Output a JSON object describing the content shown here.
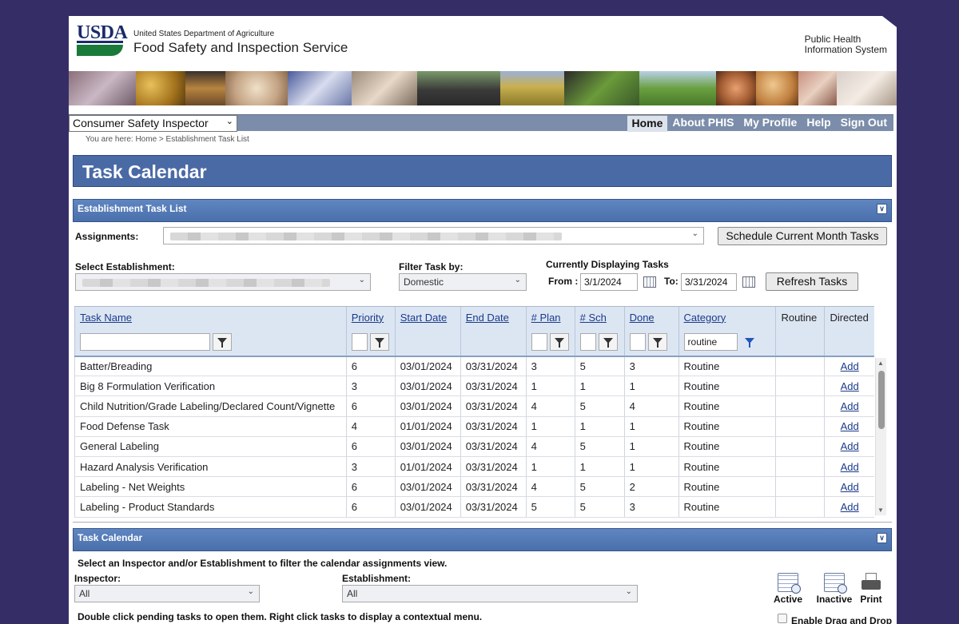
{
  "header": {
    "logo_text": "USDA",
    "agency_small": "United States Department of Agriculture",
    "agency_big": "Food Safety and Inspection Service",
    "system_line1": "Public Health",
    "system_line2": "Information System"
  },
  "nav": {
    "role": "Consumer Safety Inspector",
    "links": [
      "Home",
      "About PHIS",
      "My Profile",
      "Help",
      "Sign Out"
    ],
    "active": "Home"
  },
  "breadcrumb": "You are here: Home > Establishment Task List",
  "page_title": "Task Calendar",
  "task_list": {
    "section_title": "Establishment Task List",
    "assignments_label": "Assignments:",
    "schedule_button": "Schedule Current Month Tasks",
    "select_establishment_label": "Select Establishment:",
    "filter_label": "Filter Task by:",
    "filter_value": "Domestic",
    "displaying_label": "Currently Displaying Tasks",
    "from_label": "From :",
    "from_value": "3/1/2024",
    "to_label": "To:",
    "to_value": "3/31/2024",
    "refresh_button": "Refresh Tasks",
    "columns": [
      "Task Name",
      "Priority",
      "Start Date",
      "End Date",
      "# Plan",
      "# Sch",
      "Done",
      "Category",
      "Routine",
      "Directed"
    ],
    "category_filter": "routine",
    "rows": [
      {
        "name": "Batter/Breading",
        "priority": "6",
        "start": "03/01/2024",
        "end": "03/31/2024",
        "plan": "3",
        "sch": "5",
        "done": "3",
        "category": "Routine",
        "directed": "Add"
      },
      {
        "name": "Big 8 Formulation Verification",
        "priority": "3",
        "start": "03/01/2024",
        "end": "03/31/2024",
        "plan": "1",
        "sch": "1",
        "done": "1",
        "category": "Routine",
        "directed": "Add"
      },
      {
        "name": "Child Nutrition/Grade Labeling/Declared Count/Vignette",
        "priority": "6",
        "start": "03/01/2024",
        "end": "03/31/2024",
        "plan": "4",
        "sch": "5",
        "done": "4",
        "category": "Routine",
        "directed": "Add"
      },
      {
        "name": "Food Defense Task",
        "priority": "4",
        "start": "01/01/2024",
        "end": "03/31/2024",
        "plan": "1",
        "sch": "1",
        "done": "1",
        "category": "Routine",
        "directed": "Add"
      },
      {
        "name": "General Labeling",
        "priority": "6",
        "start": "03/01/2024",
        "end": "03/31/2024",
        "plan": "4",
        "sch": "5",
        "done": "1",
        "category": "Routine",
        "directed": "Add"
      },
      {
        "name": "Hazard Analysis Verification",
        "priority": "3",
        "start": "01/01/2024",
        "end": "03/31/2024",
        "plan": "1",
        "sch": "1",
        "done": "1",
        "category": "Routine",
        "directed": "Add"
      },
      {
        "name": "Labeling - Net Weights",
        "priority": "6",
        "start": "03/01/2024",
        "end": "03/31/2024",
        "plan": "4",
        "sch": "5",
        "done": "2",
        "category": "Routine",
        "directed": "Add"
      },
      {
        "name": "Labeling - Product Standards",
        "priority": "6",
        "start": "03/01/2024",
        "end": "03/31/2024",
        "plan": "5",
        "sch": "5",
        "done": "3",
        "category": "Routine",
        "directed": "Add"
      }
    ]
  },
  "calendar": {
    "section_title": "Task Calendar",
    "instructions": "Select an Inspector and/or Establishment to filter the calendar assignments view.",
    "inspector_label": "Inspector:",
    "inspector_value": "All",
    "establishment_label": "Establishment:",
    "establishment_value": "All",
    "hint": "Double click pending tasks to open them. Right click tasks to display a contextual menu.",
    "tools": [
      "Active",
      "Inactive",
      "Print"
    ],
    "drag_drop_label": "Enable Drag and Drop"
  },
  "colors": {
    "background": "#352d66",
    "title_bar": "#4a6aa6",
    "section_bar": "#5578b5",
    "nav_bar": "#7b8daa",
    "link": "#1a3a8a"
  }
}
